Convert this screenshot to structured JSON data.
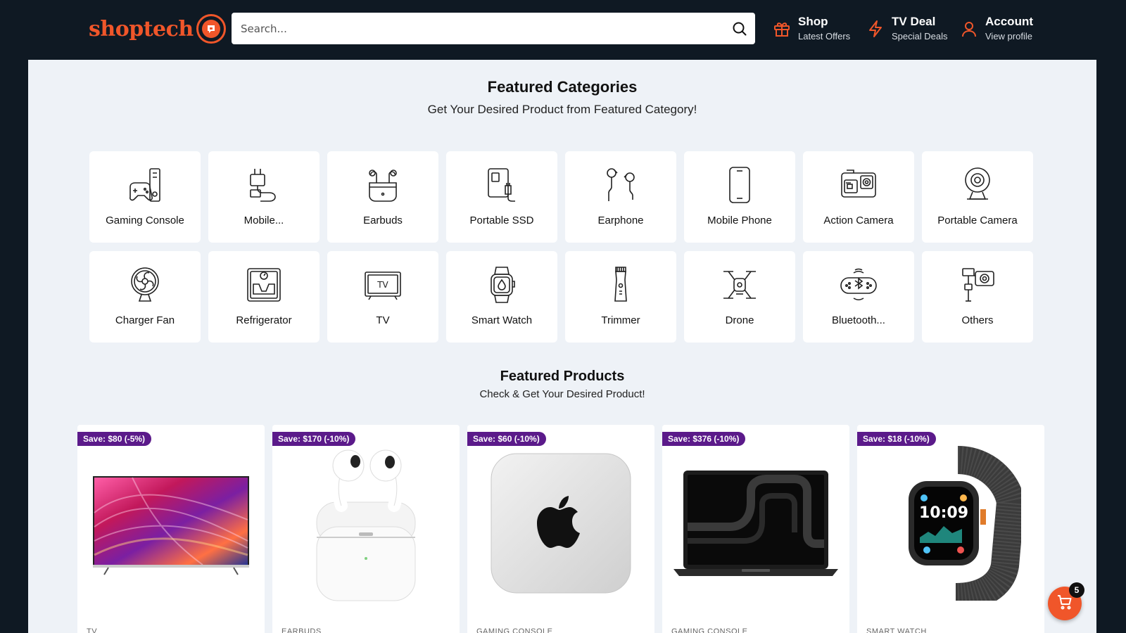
{
  "header": {
    "logo_text": "shoptech",
    "search": {
      "placeholder": "Search..."
    },
    "nav": [
      {
        "title": "Shop",
        "subtitle": "Latest Offers",
        "icon": "gift-icon"
      },
      {
        "title": "TV Deal",
        "subtitle": "Special Deals",
        "icon": "lightning-icon"
      },
      {
        "title": "Account",
        "subtitle": "View profile",
        "icon": "user-icon"
      }
    ]
  },
  "categories_section": {
    "title": "Featured Categories",
    "subtitle": "Get Your Desired Product from Featured Category!",
    "items": [
      {
        "label": "Gaming Console",
        "icon": "gaming-console-icon"
      },
      {
        "label": "Mobile...",
        "icon": "mobile-charger-icon"
      },
      {
        "label": "Earbuds",
        "icon": "earbuds-icon"
      },
      {
        "label": "Portable SSD",
        "icon": "portable-ssd-icon"
      },
      {
        "label": "Earphone",
        "icon": "earphone-icon"
      },
      {
        "label": "Mobile Phone",
        "icon": "mobile-phone-icon"
      },
      {
        "label": "Action Camera",
        "icon": "action-camera-icon"
      },
      {
        "label": "Portable Camera",
        "icon": "portable-camera-icon"
      },
      {
        "label": "Charger Fan",
        "icon": "fan-icon"
      },
      {
        "label": "Refrigerator",
        "icon": "refrigerator-icon"
      },
      {
        "label": "TV",
        "icon": "tv-icon"
      },
      {
        "label": "Smart Watch",
        "icon": "smart-watch-icon"
      },
      {
        "label": "Trimmer",
        "icon": "trimmer-icon"
      },
      {
        "label": "Drone",
        "icon": "drone-icon"
      },
      {
        "label": "Bluetooth...",
        "icon": "bluetooth-speaker-icon"
      },
      {
        "label": "Others",
        "icon": "others-icon"
      }
    ]
  },
  "products_section": {
    "title": "Featured Products",
    "subtitle": "Check & Get Your Desired Product!",
    "items": [
      {
        "badge": "Save: $80 (-5%)",
        "category": "TV",
        "image": "tv-image"
      },
      {
        "badge": "Save: $170 (-10%)",
        "category": "EARBUDS",
        "image": "earbuds-image"
      },
      {
        "badge": "Save: $60 (-10%)",
        "category": "GAMING CONSOLE",
        "image": "mac-mini-image"
      },
      {
        "badge": "Save: $376 (-10%)",
        "category": "GAMING CONSOLE",
        "image": "laptop-image"
      },
      {
        "badge": "Save: $18 (-10%)",
        "category": "SMART WATCH",
        "image": "smartwatch-image"
      }
    ]
  },
  "cart": {
    "count": "5",
    "icon": "cart-icon"
  },
  "colors": {
    "accent": "#f0562a",
    "badge": "#5b1a8a",
    "header_bg": "#0f1923",
    "main_bg": "#eef2f7"
  }
}
